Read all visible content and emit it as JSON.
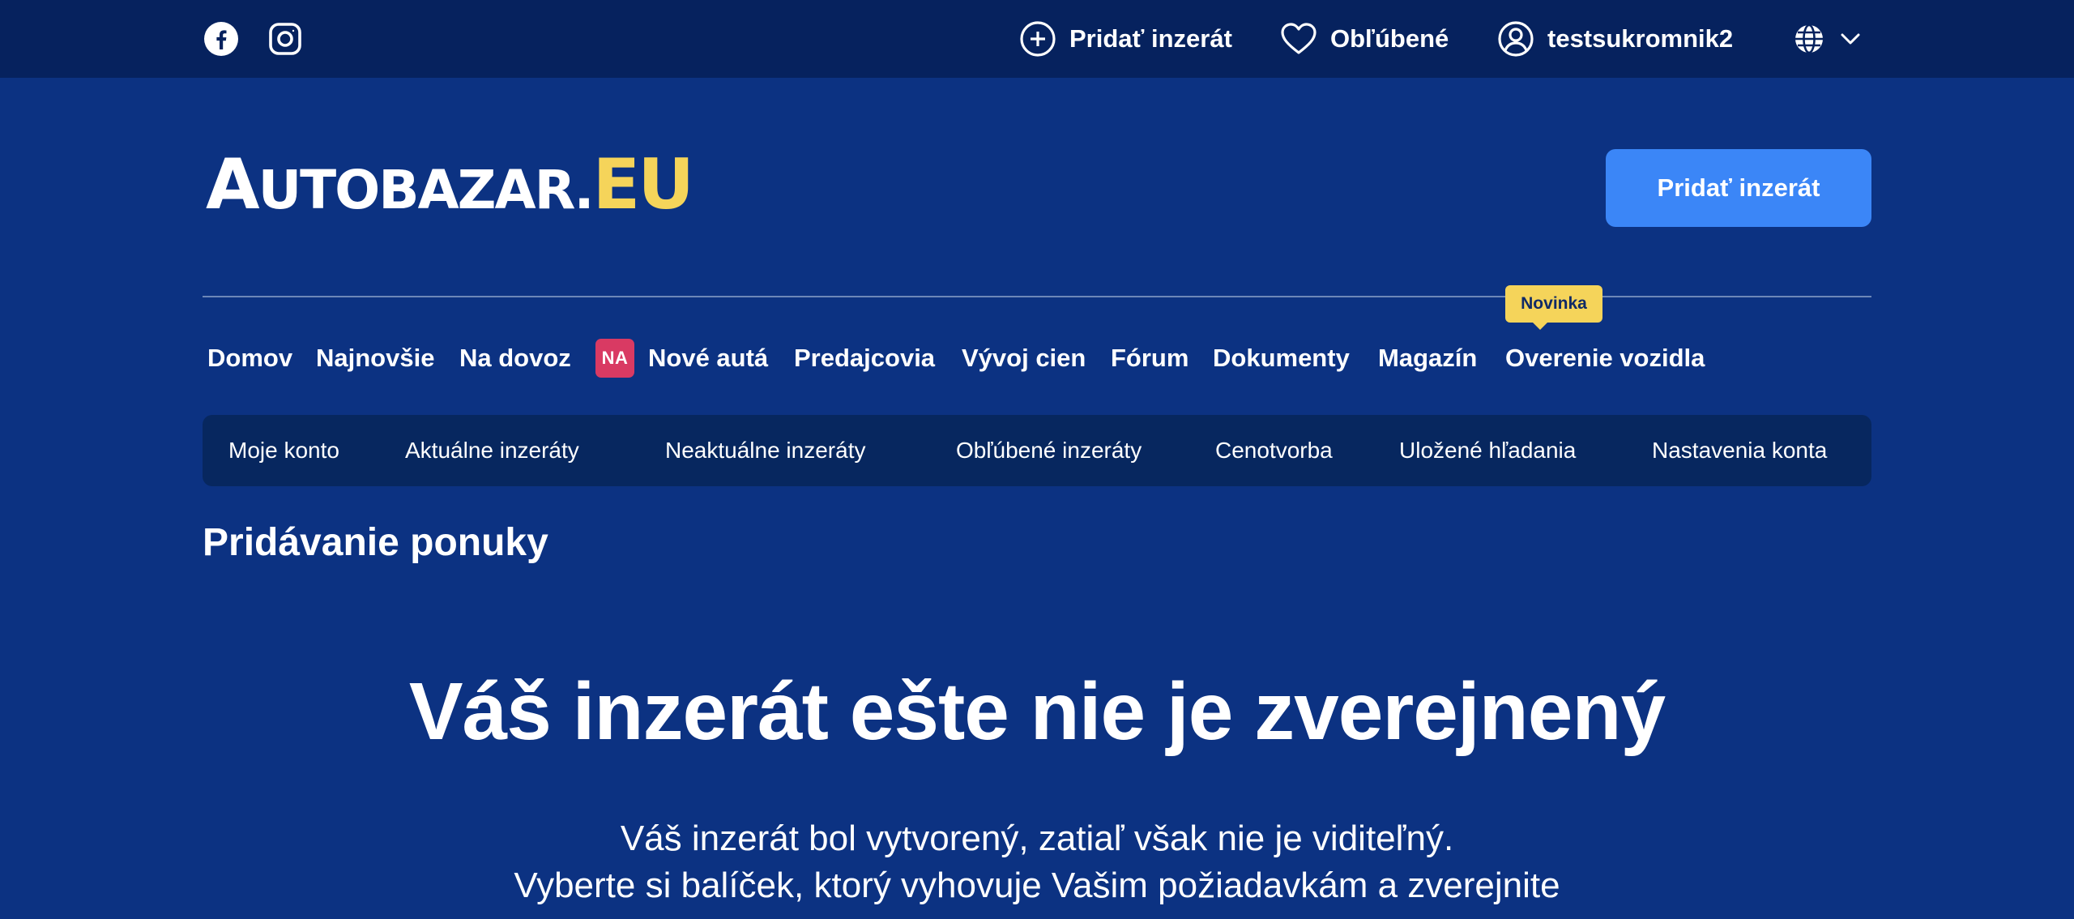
{
  "topbar": {
    "social": [
      "facebook-icon",
      "instagram-icon"
    ],
    "add_listing": "Pridať inzerát",
    "favorites": "Obľúbené",
    "username": "testsukromnik2",
    "language_icon": "globe-icon"
  },
  "header": {
    "logo": {
      "first": "A",
      "rest": "UTOBAZAR",
      "dot": ".",
      "tld": "EU"
    },
    "cta": "Pridať inzerát"
  },
  "main_nav": {
    "items": [
      {
        "label": "Domov"
      },
      {
        "label": "Najnovšie"
      },
      {
        "label": "Na dovoz"
      },
      {
        "label": "Nové autá",
        "badge": "NA"
      },
      {
        "label": "Predajcovia"
      },
      {
        "label": "Vývoj cien"
      },
      {
        "label": "Fórum"
      },
      {
        "label": "Dokumenty"
      },
      {
        "label": "Magazín"
      },
      {
        "label": "Overenie vozidla",
        "tag": "Novinka"
      }
    ]
  },
  "account_nav": {
    "items": [
      "Moje konto",
      "Aktuálne inzeráty",
      "Neaktuálne inzeráty",
      "Obľúbené inzeráty",
      "Cenotvorba",
      "Uložené hľadania",
      "Nastavenia konta"
    ]
  },
  "content": {
    "page_title": "Pridávanie ponuky",
    "hero_title": "Váš inzerát ešte nie je zverejnený",
    "hero_lines": [
      "Váš inzerát bol vytvorený, zatiaľ však nie je viditeľný.",
      "Vyberte si balíček, ktorý vyhovuje Vašim požiadavkám a zverejnite"
    ]
  },
  "colors": {
    "background": "#0c3282",
    "topbar": "#06225e",
    "subnav": "#07275f",
    "accent_button": "#3b86f7",
    "logo_accent": "#f5d45a",
    "badge_na": "#d93a63",
    "tag_novinka": "#f5d45a"
  }
}
